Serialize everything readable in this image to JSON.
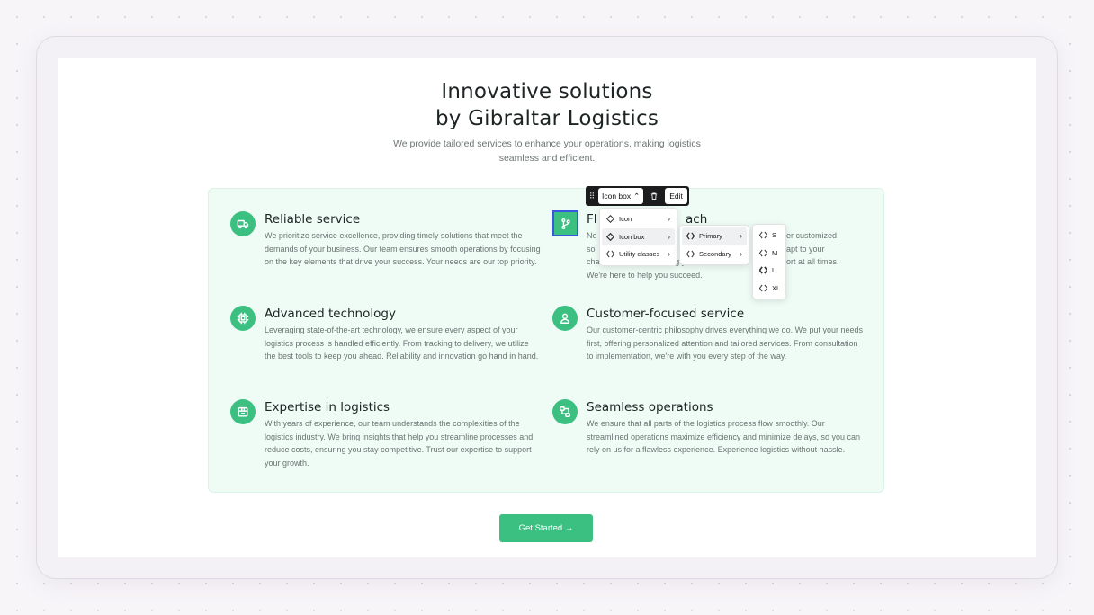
{
  "hero": {
    "title_line1": "Innovative solutions",
    "title_line2": "by Gibraltar Logistics",
    "subtitle_line1": "We provide tailored services to enhance your operations, making logistics",
    "subtitle_line2": "seamless and efficient."
  },
  "features": [
    {
      "icon": "truck-icon",
      "title": "Reliable service",
      "description": "We prioritize service excellence, providing timely solutions that meet the demands of your business. Our team ensures smooth operations by focusing on the key elements that drive your success. Your needs are our top priority."
    },
    {
      "icon": "git-branch-icon",
      "title": "Fl",
      "title_tail": "ach",
      "description_line1_head": "No",
      "description_line1_tail": "er customized",
      "description_line2_head": "so",
      "description_line2_tail": "apt to your",
      "description_line3_head": "changing needs, ensuring you have the",
      "description_line3_tail": "ort at all times.",
      "description_line4": "We're here to help you succeed."
    },
    {
      "icon": "chip-icon",
      "title": "Advanced technology",
      "description": "Leveraging state-of-the-art technology, we ensure every aspect of your logistics process is handled efficiently. From tracking to delivery, we utilize the best tools to keep you ahead. Reliability and innovation go hand in hand."
    },
    {
      "icon": "user-icon",
      "title": "Customer-focused service",
      "description": "Our customer-centric philosophy drives everything we do. We put your needs first, offering personalized attention and tailored services. From consultation to implementation, we're with you every step of the way."
    },
    {
      "icon": "package-icon",
      "title": "Expertise in logistics",
      "description": "With years of experience, our team understands the complexities of the logistics industry. We bring insights that help you streamline processes and reduce costs, ensuring you stay competitive. Trust our expertise to support your growth."
    },
    {
      "icon": "workflow-icon",
      "title": "Seamless operations",
      "description": "We ensure that all parts of the logistics process flow smoothly. Our streamlined operations maximize efficiency and minimize delays, so you can rely on us for a flawless experience. Experience logistics without hassle."
    }
  ],
  "cta": {
    "label": "Get Started →"
  },
  "toolbar": {
    "handle": "⠿",
    "selected_component": "Icon box",
    "select_arrow": "⌃",
    "delete_icon": "trash-icon",
    "edit_label": "Edit"
  },
  "menus": {
    "level1": [
      {
        "label": "Icon",
        "arrow": "›"
      },
      {
        "label": "Icon box",
        "arrow": "›"
      },
      {
        "label": "Utility classes",
        "arrow": "›"
      }
    ],
    "level2": [
      {
        "label": "Primary",
        "arrow": "›"
      },
      {
        "label": "Secondary",
        "arrow": "›"
      }
    ],
    "level3": [
      {
        "label": "S"
      },
      {
        "label": "M"
      },
      {
        "label": "L"
      },
      {
        "label": "XL"
      }
    ]
  },
  "colors": {
    "accent": "#3cc081",
    "panel": "#effcf6",
    "selection": "#3a57e0"
  }
}
